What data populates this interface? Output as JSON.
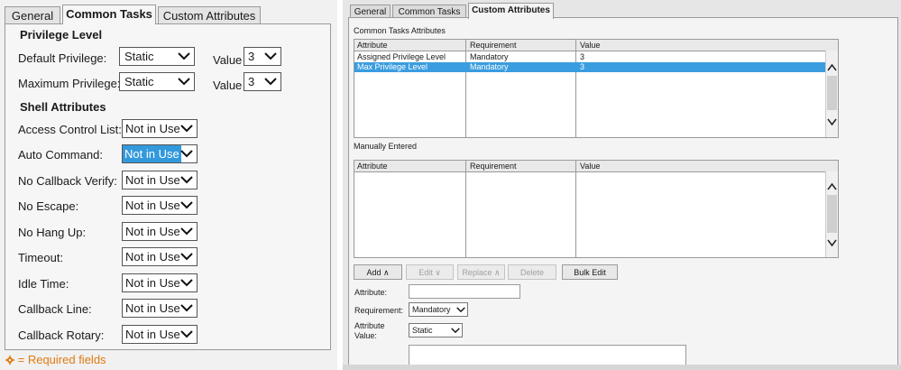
{
  "left": {
    "tabs": [
      "General",
      "Common Tasks",
      "Custom Attributes"
    ],
    "privilege_heading": "Privilege Level",
    "default_privilege": {
      "label": "Default Privilege:",
      "value": "Static",
      "value_label": "Value",
      "level": "3"
    },
    "maximum_privilege": {
      "label": "Maximum Privilege:",
      "value": "Static",
      "value_label": "Value",
      "level": "3"
    },
    "shell_heading": "Shell Attributes",
    "shell_fields": [
      {
        "label": "Access Control List:",
        "value": "Not in Use"
      },
      {
        "label": "Auto Command:",
        "value": "Not in Use"
      },
      {
        "label": "No Callback Verify:",
        "value": "Not in Use"
      },
      {
        "label": "No Escape:",
        "value": "Not in Use"
      },
      {
        "label": "No Hang Up:",
        "value": "Not in Use"
      },
      {
        "label": "Timeout:",
        "value": "Not in Use"
      },
      {
        "label": "Idle Time:",
        "value": "Not in Use"
      },
      {
        "label": "Callback Line:",
        "value": "Not in Use"
      },
      {
        "label": "Callback Rotary:",
        "value": "Not in Use"
      }
    ],
    "required_note": "= Required fields"
  },
  "right": {
    "tabs": [
      "General",
      "Common Tasks",
      "Custom Attributes"
    ],
    "common_tasks_caption": "Common Tasks Attributes",
    "columns": [
      "Attribute",
      "Requirement",
      "Value"
    ],
    "common_rows": [
      {
        "attribute": "Assigned Privilege Level",
        "requirement": "Mandatory",
        "value": "3"
      },
      {
        "attribute": "Max Privilege Level",
        "requirement": "Mandatory",
        "value": "3"
      }
    ],
    "manual_caption": "Manually Entered",
    "buttons": {
      "add": "Add ∧",
      "edit": "Edit ∨",
      "replace": "Replace ∧",
      "delete": "Delete",
      "bulk_edit": "Bulk Edit"
    },
    "form": {
      "attribute_label": "Attribute:",
      "attribute_value": "",
      "requirement_label": "Requirement:",
      "requirement_value": "Mandatory",
      "attribute_value_label_1": "Attribute",
      "attribute_value_label_2": "Value:",
      "value_type": "Static"
    }
  },
  "colors": {
    "selection": "#3a9de0",
    "required": "#e07a10"
  }
}
